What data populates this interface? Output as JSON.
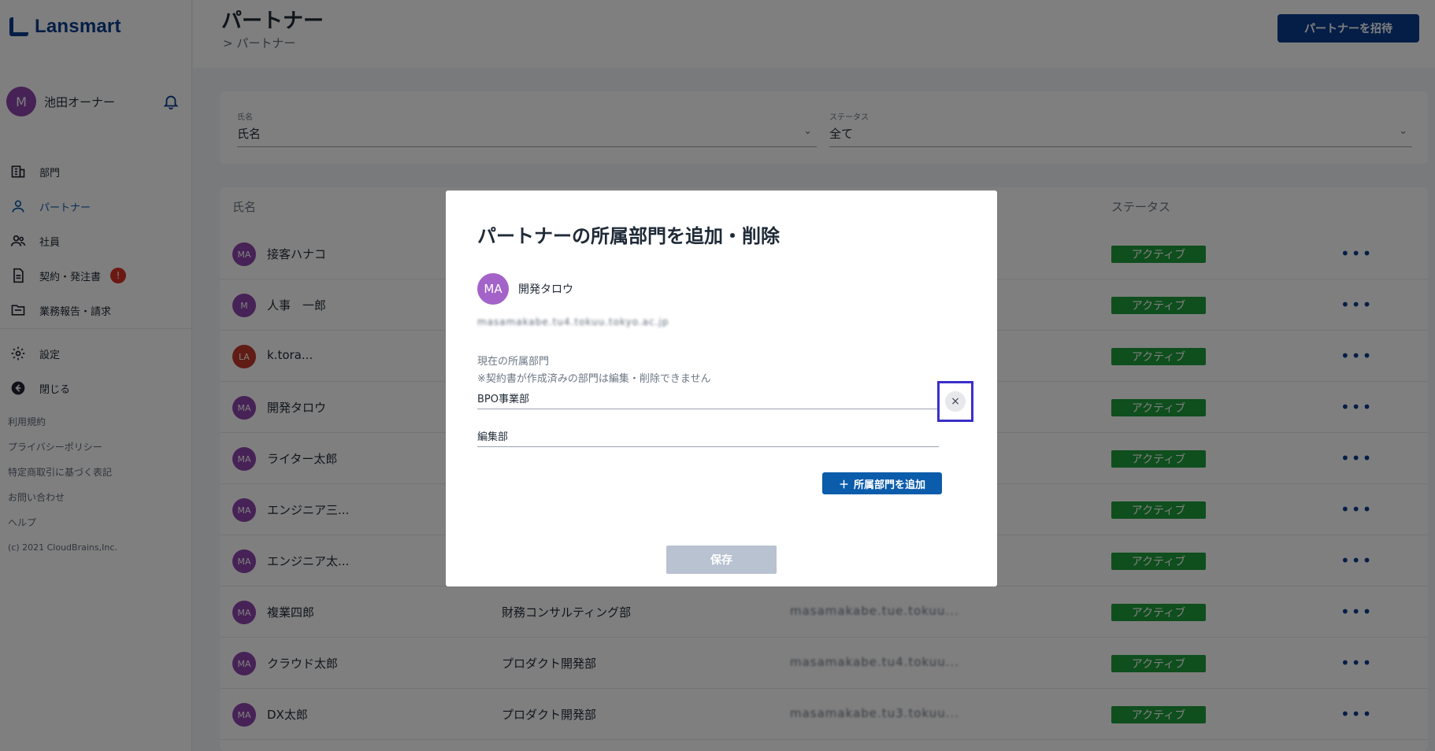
{
  "app": {
    "brand": "Lansmart"
  },
  "user": {
    "initial": "M",
    "name": "池田オーナー"
  },
  "nav": {
    "items": [
      {
        "label": "部門"
      },
      {
        "label": "パートナー"
      },
      {
        "label": "社員"
      },
      {
        "label": "契約・発注書",
        "badge": "!"
      },
      {
        "label": "業務報告・請求"
      }
    ],
    "bottom": [
      {
        "label": "設定"
      },
      {
        "label": "閉じる"
      }
    ],
    "links": [
      "利用規約",
      "プライバシーポリシー",
      "特定商取引に基づく表記",
      "お問い合わせ",
      "ヘルプ"
    ],
    "copyright": "(c) 2021 CloudBrains,Inc."
  },
  "header": {
    "title": "パートナー",
    "breadcrumb": "> パートナー",
    "invite_label": "パートナーを招待"
  },
  "filters": {
    "name": {
      "label": "氏名",
      "value": "氏名"
    },
    "status": {
      "label": "ステータス",
      "value": "全て"
    }
  },
  "table": {
    "headers": {
      "name": "氏名",
      "status": "ステータス"
    },
    "rows": [
      {
        "initials": "MA",
        "name": "接客ハナコ",
        "dept": "",
        "email": "",
        "status": "アクティブ"
      },
      {
        "initials": "M",
        "name": "人事　一郎",
        "dept": "",
        "email": "",
        "status": "アクティブ"
      },
      {
        "initials": "LA",
        "name": "k.tora...",
        "dept": "",
        "email": "",
        "status": "アクティブ"
      },
      {
        "initials": "MA",
        "name": "開発タロウ",
        "dept": "",
        "email": "",
        "status": "アクティブ"
      },
      {
        "initials": "MA",
        "name": "ライター太郎",
        "dept": "",
        "email": "",
        "status": "アクティブ"
      },
      {
        "initials": "MA",
        "name": "エンジニア三...",
        "dept": "",
        "email": "",
        "status": "アクティブ"
      },
      {
        "initials": "MA",
        "name": "エンジニア太...",
        "dept": "",
        "email": "",
        "status": "アクティブ"
      },
      {
        "initials": "MA",
        "name": "複業四郎",
        "dept": "財務コンサルティング部",
        "email": "masamakabe.tue.tokuu...",
        "status": "アクティブ"
      },
      {
        "initials": "MA",
        "name": "クラウド太郎",
        "dept": "プロダクト開発部",
        "email": "masamakabe.tu4.tokuu...",
        "status": "アクティブ"
      },
      {
        "initials": "MA",
        "name": "DX太郎",
        "dept": "プロダクト開発部",
        "email": "masamakabe.tu3.tokuu...",
        "status": "アクティブ"
      }
    ]
  },
  "modal": {
    "title": "パートナーの所属部門を追加・削除",
    "user_initials": "MA",
    "user_name": "開発タロウ",
    "user_email": "masamakabe.tu4.tokuu.tokyo.ac.jp",
    "current_label": "現在の所属部門",
    "note": "※契約書が作成済みの部門は編集・削除できません",
    "departments": [
      "BPO事業部",
      "編集部"
    ],
    "remove_icon": "×",
    "add_label": "所属部門を追加",
    "save_label": "保存"
  },
  "colors": {
    "brand": "#0b3d8f",
    "status_active": "#1f9d3a",
    "alert": "#d93025",
    "highlight": "#3a2fc9"
  }
}
